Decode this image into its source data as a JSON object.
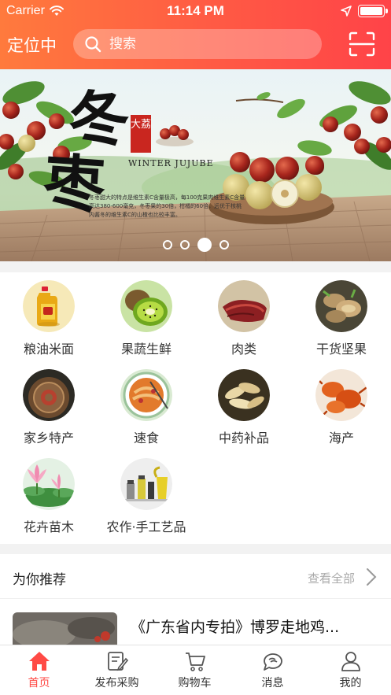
{
  "status_bar": {
    "carrier": "Carrier",
    "time": "11:14 PM"
  },
  "header": {
    "location_label": "定位中",
    "search_placeholder": "搜索"
  },
  "banner": {
    "title_chars": [
      "冬",
      "枣"
    ],
    "tag": "大荔",
    "subtitle": "WINTER JUJUBE",
    "description": "冬枣甜大的特点是维生素C含量极高，每100克果肉维生素C含量高达380-600毫克，冬枣果的30倍，柑橘的60倍，远优于核桃内酱冬的维生素C的山楂也比较丰富。",
    "page_count": 4,
    "active_page": 3
  },
  "categories": [
    {
      "label": "粮油米面",
      "icon": "grain-oil-icon"
    },
    {
      "label": "果蔬生鲜",
      "icon": "kiwi-icon"
    },
    {
      "label": "肉类",
      "icon": "meat-icon"
    },
    {
      "label": "干货坚果",
      "icon": "dried-goods-icon"
    },
    {
      "label": "家乡特产",
      "icon": "tea-cake-icon"
    },
    {
      "label": "速食",
      "icon": "fast-food-icon"
    },
    {
      "label": "中药补品",
      "icon": "herbal-icon"
    },
    {
      "label": "海产",
      "icon": "crab-icon"
    },
    {
      "label": "花卉苗木",
      "icon": "lotus-icon"
    },
    {
      "label": "农作·手工艺品",
      "icon": "craft-icon"
    }
  ],
  "recommend": {
    "title": "为你推荐",
    "more": "查看全部",
    "first_item_title": "《广东省内专拍》博罗走地鸡..."
  },
  "tabbar": {
    "active_index": 0,
    "accent_color": "#ff4a45",
    "tabs": [
      {
        "label": "首页",
        "icon": "home-icon"
      },
      {
        "label": "发布采购",
        "icon": "edit-icon"
      },
      {
        "label": "购物车",
        "icon": "cart-icon"
      },
      {
        "label": "消息",
        "icon": "message-icon"
      },
      {
        "label": "我的",
        "icon": "profile-icon"
      }
    ]
  }
}
